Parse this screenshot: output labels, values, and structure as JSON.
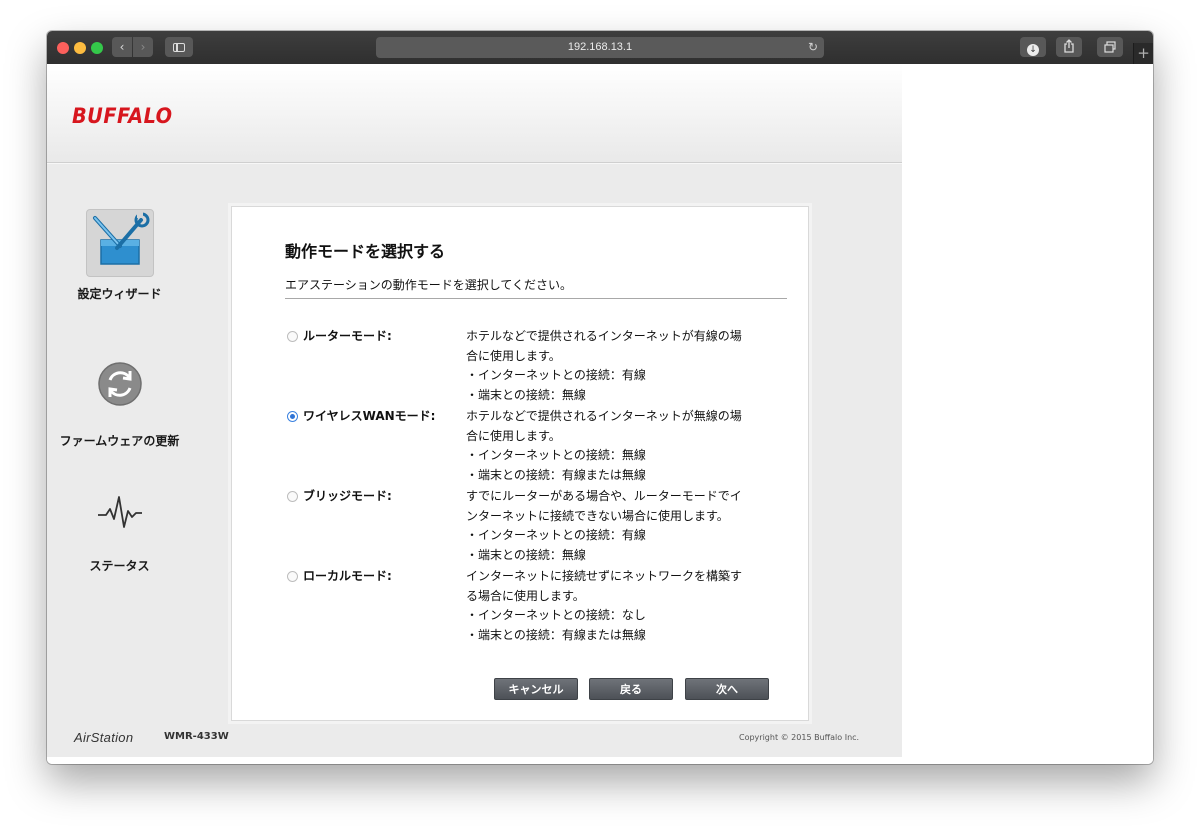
{
  "browser": {
    "url": "192.168.13.1",
    "icons": {
      "back": "chevron-left-icon",
      "forward": "chevron-right-icon",
      "sidebar": "sidebar-icon",
      "reload": "reload-icon",
      "download": "download-icon",
      "share": "share-icon",
      "tabs": "tabs-icon",
      "new_tab": "plus-icon"
    }
  },
  "header": {
    "logo": "BUFFALO",
    "logo_color": "#d7161e"
  },
  "sidebar": {
    "items": [
      {
        "label": "設定ウィザード",
        "icon": "toolbox-icon",
        "active": true
      },
      {
        "label": "ファームウェアの更新",
        "icon": "refresh-icon",
        "active": false
      },
      {
        "label": "ステータス",
        "icon": "pulse-icon",
        "active": false
      }
    ]
  },
  "panel": {
    "title": "動作モードを選択する",
    "description": "エアステーションの動作モードを選択してください。",
    "modes": [
      {
        "label": "ルーターモード:",
        "selected": false,
        "lines": [
          "ホテルなどで提供されるインターネットが有線の場",
          "合に使用します。",
          "・インターネットとの接続：有線",
          "・端末との接続：無線"
        ]
      },
      {
        "label": "ワイヤレスWANモード:",
        "selected": true,
        "lines": [
          "ホテルなどで提供されるインターネットが無線の場",
          "合に使用します。",
          "・インターネットとの接続：無線",
          "・端末との接続：有線または無線"
        ]
      },
      {
        "label": "ブリッジモード:",
        "selected": false,
        "lines": [
          "すでにルーターがある場合や、ルーターモードでイ",
          "ンターネットに接続できない場合に使用します。",
          "・インターネットとの接続：有線",
          "・端末との接続：無線"
        ]
      },
      {
        "label": "ローカルモード:",
        "selected": false,
        "lines": [
          "インターネットに接続せずにネットワークを構築す",
          "る場合に使用します。",
          "・インターネットとの接続：なし",
          "・端末との接続：有線または無線"
        ]
      }
    ],
    "buttons": {
      "cancel": "キャンセル",
      "back": "戻る",
      "next": "次へ"
    },
    "accent_color": "#2f74d6"
  },
  "footer": {
    "brand": "AirStation",
    "model": "WMR-433W",
    "copyright": "Copyright © 2015 Buffalo Inc."
  }
}
